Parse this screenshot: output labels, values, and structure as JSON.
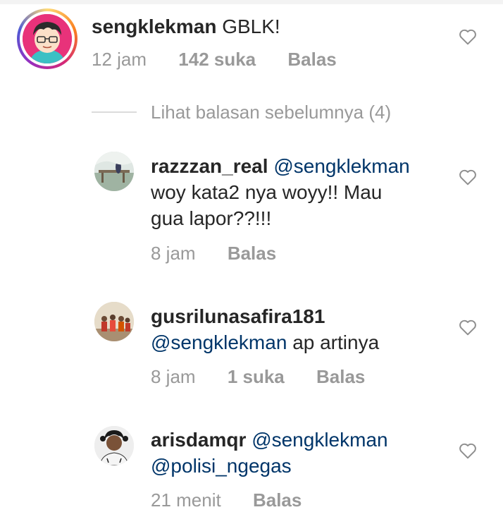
{
  "comments": [
    {
      "username": "sengklekman",
      "mention": "",
      "text": "GBLK!",
      "time": "12 jam",
      "likes": "142 suka",
      "reply": "Balas",
      "avatar_icon": "cartoon-face-avatar"
    }
  ],
  "view_previous": "Lihat balasan sebelumnya (4)",
  "replies": [
    {
      "username": "razzzan_real",
      "mention": "@sengklekman",
      "text_line1": "woy kata2 nya woyy!! Mau",
      "text_line2": "gua lapor??!!!",
      "time": "8 jam",
      "likes": "",
      "reply": "Balas"
    },
    {
      "username": "gusrilunasafira181",
      "mention": "@sengklekman",
      "text": "ap artinya",
      "time": "8 jam",
      "likes": "1 suka",
      "reply": "Balas"
    },
    {
      "username": "arisdamqr",
      "mention": "@sengklekman",
      "mention2": "@polisi_ngegas",
      "time": "21 menit",
      "likes": "",
      "reply": "Balas"
    }
  ],
  "colors": {
    "text": "#262626",
    "meta": "#999999",
    "mention": "#003569",
    "story_ring": "#d62976"
  }
}
